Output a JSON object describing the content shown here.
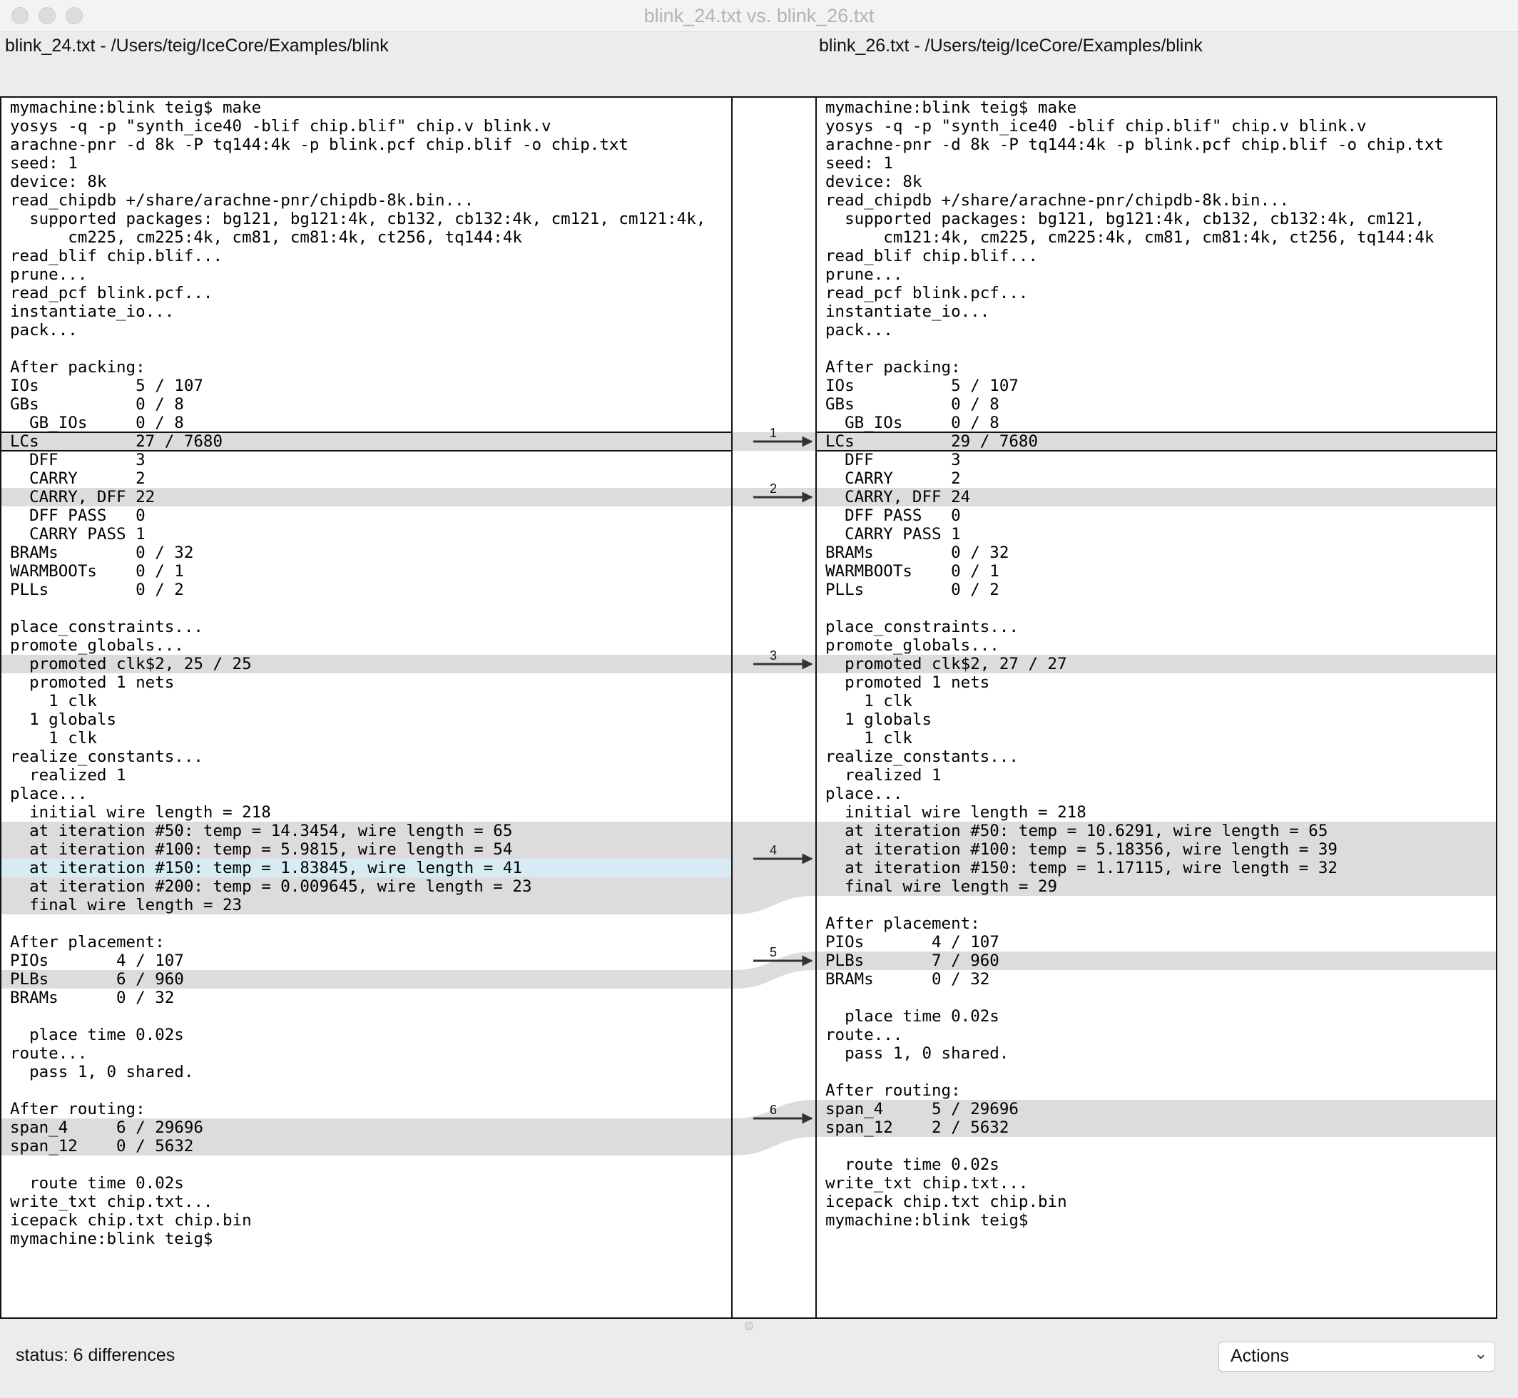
{
  "window": {
    "title": "blink_24.txt vs. blink_26.txt"
  },
  "left": {
    "path": "blink_24.txt - /Users/teig/IceCore/Examples/blink",
    "lines": [
      {
        "t": "mymachine:blink teig$ make"
      },
      {
        "t": "yosys -q -p \"synth_ice40 -blif chip.blif\" chip.v blink.v"
      },
      {
        "t": "arachne-pnr -d 8k -P tq144:4k -p blink.pcf chip.blif -o chip.txt"
      },
      {
        "t": "seed: 1"
      },
      {
        "t": "device: 8k"
      },
      {
        "t": "read_chipdb +/share/arachne-pnr/chipdb-8k.bin..."
      },
      {
        "t": "  supported packages: bg121, bg121:4k, cb132, cb132:4k, cm121, cm121:4k,"
      },
      {
        "t": "      cm225, cm225:4k, cm81, cm81:4k, ct256, tq144:4k"
      },
      {
        "t": "read_blif chip.blif..."
      },
      {
        "t": "prune..."
      },
      {
        "t": "read_pcf blink.pcf..."
      },
      {
        "t": "instantiate_io..."
      },
      {
        "t": "pack..."
      },
      {
        "t": ""
      },
      {
        "t": "After packing:"
      },
      {
        "t": "IOs          5 / 107"
      },
      {
        "t": "GBs          0 / 8"
      },
      {
        "t": "  GB_IOs     0 / 8"
      },
      {
        "t": "LCs          27 / 7680",
        "hl": "gray"
      },
      {
        "t": "  DFF        3"
      },
      {
        "t": "  CARRY      2"
      },
      {
        "t": "  CARRY, DFF 22",
        "hl": "gray"
      },
      {
        "t": "  DFF PASS   0"
      },
      {
        "t": "  CARRY PASS 1"
      },
      {
        "t": "BRAMs        0 / 32"
      },
      {
        "t": "WARMBOOTs    0 / 1"
      },
      {
        "t": "PLLs         0 / 2"
      },
      {
        "t": ""
      },
      {
        "t": "place_constraints..."
      },
      {
        "t": "promote_globals..."
      },
      {
        "t": "  promoted clk$2, 25 / 25",
        "hl": "gray"
      },
      {
        "t": "  promoted 1 nets"
      },
      {
        "t": "    1 clk"
      },
      {
        "t": "  1 globals"
      },
      {
        "t": "    1 clk"
      },
      {
        "t": "realize_constants..."
      },
      {
        "t": "  realized 1"
      },
      {
        "t": "place..."
      },
      {
        "t": "  initial wire length = 218"
      },
      {
        "t": "  at iteration #50: temp = 14.3454, wire length = 65",
        "hl": "gray"
      },
      {
        "t": "  at iteration #100: temp = 5.9815, wire length = 54",
        "hl": "gray"
      },
      {
        "t": "  at iteration #150: temp = 1.83845, wire length = 41",
        "hl": "blue"
      },
      {
        "t": "  at iteration #200: temp = 0.009645, wire length = 23",
        "hl": "gray"
      },
      {
        "t": "  final wire length = 23",
        "hl": "gray"
      },
      {
        "t": ""
      },
      {
        "t": "After placement:"
      },
      {
        "t": "PIOs       4 / 107"
      },
      {
        "t": "PLBs       6 / 960",
        "hl": "gray"
      },
      {
        "t": "BRAMs      0 / 32"
      },
      {
        "t": ""
      },
      {
        "t": "  place time 0.02s"
      },
      {
        "t": "route..."
      },
      {
        "t": "  pass 1, 0 shared."
      },
      {
        "t": ""
      },
      {
        "t": "After routing:"
      },
      {
        "t": "span_4     6 / 29696",
        "hl": "gray"
      },
      {
        "t": "span_12    0 / 5632",
        "hl": "gray"
      },
      {
        "t": ""
      },
      {
        "t": "  route time 0.02s"
      },
      {
        "t": "write_txt chip.txt..."
      },
      {
        "t": "icepack chip.txt chip.bin"
      },
      {
        "t": "mymachine:blink teig$"
      }
    ]
  },
  "right": {
    "path": "blink_26.txt - /Users/teig/IceCore/Examples/blink",
    "lines": [
      {
        "t": "mymachine:blink teig$ make"
      },
      {
        "t": "yosys -q -p \"synth_ice40 -blif chip.blif\" chip.v blink.v"
      },
      {
        "t": "arachne-pnr -d 8k -P tq144:4k -p blink.pcf chip.blif -o chip.txt"
      },
      {
        "t": "seed: 1"
      },
      {
        "t": "device: 8k"
      },
      {
        "t": "read_chipdb +/share/arachne-pnr/chipdb-8k.bin..."
      },
      {
        "t": "  supported packages: bg121, bg121:4k, cb132, cb132:4k, cm121,"
      },
      {
        "t": "      cm121:4k, cm225, cm225:4k, cm81, cm81:4k, ct256, tq144:4k"
      },
      {
        "t": "read_blif chip.blif..."
      },
      {
        "t": "prune..."
      },
      {
        "t": "read_pcf blink.pcf..."
      },
      {
        "t": "instantiate_io..."
      },
      {
        "t": "pack..."
      },
      {
        "t": ""
      },
      {
        "t": "After packing:"
      },
      {
        "t": "IOs          5 / 107"
      },
      {
        "t": "GBs          0 / 8"
      },
      {
        "t": "  GB_IOs     0 / 8"
      },
      {
        "t": "LCs          29 / 7680",
        "hl": "gray"
      },
      {
        "t": "  DFF        3"
      },
      {
        "t": "  CARRY      2"
      },
      {
        "t": "  CARRY, DFF 24",
        "hl": "gray"
      },
      {
        "t": "  DFF PASS   0"
      },
      {
        "t": "  CARRY PASS 1"
      },
      {
        "t": "BRAMs        0 / 32"
      },
      {
        "t": "WARMBOOTs    0 / 1"
      },
      {
        "t": "PLLs         0 / 2"
      },
      {
        "t": ""
      },
      {
        "t": "place_constraints..."
      },
      {
        "t": "promote_globals..."
      },
      {
        "t": "  promoted clk$2, 27 / 27",
        "hl": "gray"
      },
      {
        "t": "  promoted 1 nets"
      },
      {
        "t": "    1 clk"
      },
      {
        "t": "  1 globals"
      },
      {
        "t": "    1 clk"
      },
      {
        "t": "realize_constants..."
      },
      {
        "t": "  realized 1"
      },
      {
        "t": "place..."
      },
      {
        "t": "  initial wire length = 218"
      },
      {
        "t": "  at iteration #50: temp = 10.6291, wire length = 65",
        "hl": "gray"
      },
      {
        "t": "  at iteration #100: temp = 5.18356, wire length = 39",
        "hl": "gray"
      },
      {
        "t": "  at iteration #150: temp = 1.17115, wire length = 32",
        "hl": "gray"
      },
      {
        "t": "  final wire length = 29",
        "hl": "gray"
      },
      {
        "t": ""
      },
      {
        "t": "After placement:"
      },
      {
        "t": "PIOs       4 / 107"
      },
      {
        "t": "PLBs       7 / 960",
        "hl": "gray"
      },
      {
        "t": "BRAMs      0 / 32"
      },
      {
        "t": ""
      },
      {
        "t": "  place time 0.02s"
      },
      {
        "t": "route..."
      },
      {
        "t": "  pass 1, 0 shared."
      },
      {
        "t": ""
      },
      {
        "t": "After routing:"
      },
      {
        "t": "span_4     5 / 29696",
        "hl": "gray"
      },
      {
        "t": "span_12    2 / 5632",
        "hl": "gray"
      },
      {
        "t": ""
      },
      {
        "t": "  route time 0.02s"
      },
      {
        "t": "write_txt chip.txt..."
      },
      {
        "t": "icepack chip.txt chip.bin"
      },
      {
        "t": "mymachine:blink teig$"
      }
    ]
  },
  "diffs": [
    {
      "label": "1",
      "left": [
        18,
        18
      ],
      "right": [
        18,
        18
      ]
    },
    {
      "label": "2",
      "left": [
        21,
        21
      ],
      "right": [
        21,
        21
      ]
    },
    {
      "label": "3",
      "left": [
        30,
        30
      ],
      "right": [
        30,
        30
      ]
    },
    {
      "label": "4",
      "left": [
        39,
        43
      ],
      "right": [
        39,
        42
      ]
    },
    {
      "label": "5",
      "left": [
        47,
        47
      ],
      "right": [
        46,
        46
      ]
    },
    {
      "label": "6",
      "left": [
        55,
        56
      ],
      "right": [
        54,
        55
      ]
    }
  ],
  "status": {
    "label": "status:",
    "value": "6 differences"
  },
  "actions": {
    "label": "Actions",
    "chevron_icon": "chevron-down-icon"
  }
}
